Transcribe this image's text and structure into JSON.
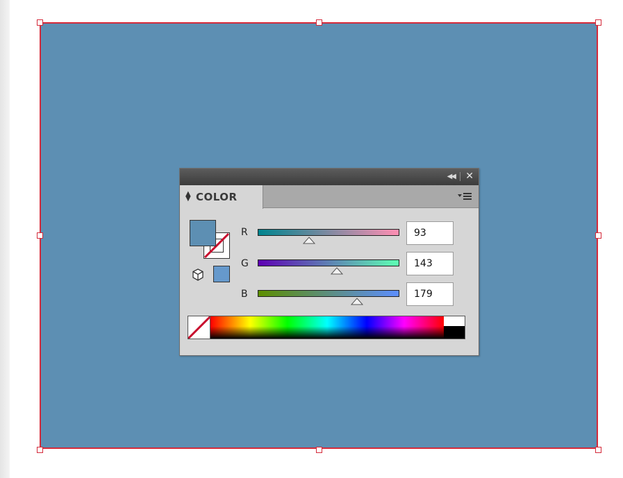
{
  "canvas": {
    "artboard_color": "#5d8fb3",
    "selection_color": "#d42a3a"
  },
  "panel": {
    "collapse_icon": "double-left-arrow-icon",
    "close_icon": "close-icon",
    "tab_label": "COLOR",
    "menu_icon": "panel-menu-icon",
    "fill_color": "#5d8fb3",
    "web_safe_color": "#6699cc",
    "channels": [
      {
        "label": "R",
        "value": "93",
        "fraction": 0.365,
        "gradient_from": "#00858f",
        "gradient_to": "#ff8fb3"
      },
      {
        "label": "G",
        "value": "143",
        "fraction": 0.561,
        "gradient_from": "#5d00b3",
        "gradient_to": "#5dffb3"
      },
      {
        "label": "B",
        "value": "179",
        "fraction": 0.702,
        "gradient_from": "#5d8f00",
        "gradient_to": "#5d8fff"
      }
    ]
  }
}
